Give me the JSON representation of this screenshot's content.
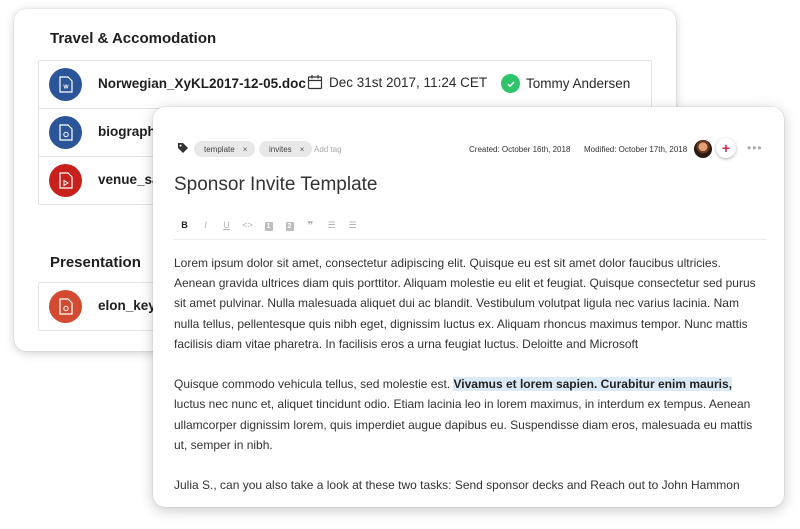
{
  "back_card": {
    "section1_title": "Travel & Accomodation",
    "files": [
      {
        "name": "Norwegian_XyKL2017-12-05.doc",
        "date": "Dec 31st 2017, 11:24 CET",
        "owner": "Tommy Andersen",
        "icon": "word-doc-icon",
        "color": "#2a5699"
      },
      {
        "name": "biography",
        "icon": "generic-doc-icon",
        "color": "#2a5699"
      },
      {
        "name": "venue_sa",
        "icon": "pdf-doc-icon",
        "color": "#c8201c"
      }
    ],
    "section2_title": "Presentation",
    "files2": [
      {
        "name": "elon_keyn",
        "icon": "slides-doc-icon",
        "color": "#d24a2f"
      }
    ]
  },
  "doc": {
    "tags": [
      {
        "label": "template",
        "remove": "×"
      },
      {
        "label": "invites",
        "remove": "×"
      }
    ],
    "add_tag_placeholder": "Add tag",
    "created": "Created: October 16th, 2018",
    "modified": "Modified: October 17th, 2018",
    "add_label": "+",
    "more_label": "•••",
    "title": "Sponsor Invite Template",
    "toolbar": {
      "bold": "B",
      "italic": "I",
      "underline": "U",
      "code": "<>",
      "h1": "1",
      "h2": "2",
      "quote": "❞",
      "ordered": "☰",
      "bulleted": "☰"
    },
    "paragraph1": "Lorem ipsum dolor sit amet, consectetur adipiscing elit. Quisque eu est sit amet dolor faucibus ultricies. Aenean gravida ultrices diam quis porttitor. Aliquam molestie eu elit et feugiat. Quisque consectetur sed purus sit amet pulvinar. Nulla malesuada aliquet dui ac blandit. Vestibulum volutpat ligula nec varius lacinia. Nam nulla tellus, pellentesque quis nibh eget, dignissim luctus ex. Aliquam rhoncus maximus tempor. Nunc mattis facilisis diam vitae pharetra. In facilisis eros a urna feugiat luctus. Deloitte and Microsoft",
    "paragraph2_before": "Quisque commodo vehicula tellus, sed molestie est. ",
    "paragraph2_highlight": "Vivamus et lorem sapien. Curabitur enim mauris,",
    "paragraph2_after": " luctus nec nunc et, aliquet tincidunt odio. Etiam lacinia leo in lorem maximus, in interdum ex tempus. Aenean ullamcorper dignissim lorem, quis imperdiet augue dapibus eu. Suspendisse diam eros, malesuada eu mattis ut, semper in nibh.",
    "paragraph3": "Julia S., can you also take a look at these two tasks: Send sponsor decks and Reach out to John Hammon"
  },
  "colors": {
    "accent_add": "#d0264a",
    "check_green": "#2ec46b",
    "highlight": "#dbeaf7"
  }
}
